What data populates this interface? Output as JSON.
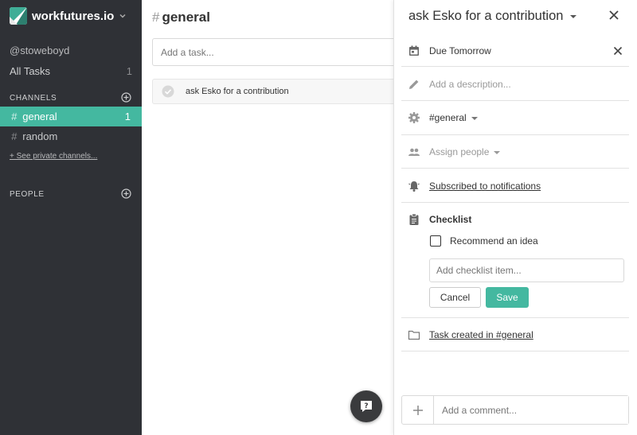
{
  "workspace": {
    "name": "workfutures.io"
  },
  "user": {
    "handle": "@stoweboyd"
  },
  "all_tasks": {
    "label": "All Tasks",
    "count": "1"
  },
  "channels": {
    "title": "CHANNELS",
    "items": [
      {
        "hash": "#",
        "name": "general",
        "count": "1",
        "active": true
      },
      {
        "hash": "#",
        "name": "random",
        "count": "",
        "active": false
      }
    ],
    "see_private": "+ See private channels..."
  },
  "people": {
    "title": "PEOPLE"
  },
  "main": {
    "hash": "#",
    "title": "general",
    "new_task_placeholder": "Add a task...",
    "tasks": [
      {
        "text": "ask Esko for a contribution"
      }
    ]
  },
  "panel": {
    "title": "ask Esko for a contribution",
    "due": "Due Tomorrow",
    "description_placeholder": "Add a description...",
    "channel": "#general",
    "assign": "Assign people",
    "subscribed": "Subscribed to notifications",
    "checklist_title": "Checklist",
    "checklist_items": [
      {
        "label": "Recommend an idea",
        "checked": false
      }
    ],
    "checklist_placeholder": "Add checklist item...",
    "cancel_label": "Cancel",
    "save_label": "Save",
    "created": "Task created in #general",
    "comment_placeholder": "Add a comment..."
  },
  "colors": {
    "accent": "#44b8a0",
    "sidebar": "#2f3136"
  },
  "icons": {
    "help": "question-bubble-icon",
    "due": "calendar-icon",
    "description": "pencil-icon",
    "channel": "gear-icon",
    "assign": "people-icon",
    "subscribed": "bell-icon",
    "checklist": "clipboard-icon",
    "created": "folder-icon"
  }
}
